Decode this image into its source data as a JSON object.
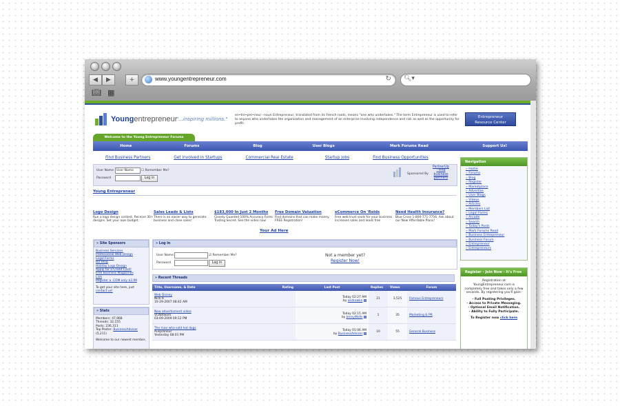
{
  "browser": {
    "url": "www.youngentrepreneur.com",
    "back_icon": "left-arrow-icon",
    "forward_icon": "right-arrow-icon",
    "add_icon": "plus-icon",
    "reload_icon": "reload-icon",
    "search_icon": "magnifier-icon",
    "bookmarks_icon": "book-icon",
    "grid_icon": "grid-icon"
  },
  "site": {
    "logo_brand": "Young",
    "logo_brand2": "entrepreneur",
    "tagline": "\"...inspiring millions.\"",
    "definition": "en•tre•pre•neur –noun Entrepreneur, translated from its French roots, means \"one who undertakes.\" The term Entrepreneur is used to refer to anyone who undertakes the organization and management of an enterprise involving independence and risk as well as the opportunity for profit.",
    "resource_center_line1": "Entrepreneur",
    "resource_center_line2": "Resource Center",
    "welcome_tab": "Welcome to the Young Entrepreneur Forums",
    "nav": [
      "Home",
      "Forums",
      "Blog",
      "User Blogs",
      "Mark Forums Read",
      "Support Us!"
    ],
    "subnav": [
      "Find Business Partners",
      "Get Involved in Startups",
      "Commercial Real Estate",
      "Startup Jobs",
      "Find Business Opportunities"
    ],
    "login": {
      "username_label": "User Name",
      "username_value": "User Name",
      "remember": "Remember Me?",
      "password_label": "Password",
      "button": "Log in"
    },
    "sponsor": {
      "sponsored_by": "Sponsored By",
      "partner_line1": "PartnerUp",
      "partner_line2": "- Find",
      "partner_line3": "business",
      "partner_line4": "partners"
    },
    "breadcrumb": "Young Entrepreneur",
    "ads": [
      {
        "title": "Logo Design",
        "text": "Run a logo design contest. Receive 30+ designs. Set your own budget."
      },
      {
        "title": "Sales Leads & Lists",
        "text": "There is an easier way to generate business and close sales!"
      },
      {
        "title": "$183,000 In Just 2 Months",
        "text": "Closely Guarded 100% Accuracy Forex Trading Secret. See the video now"
      },
      {
        "title": "Free Domain Valuation",
        "text": "Find domains that can make money. FREE Registration!"
      },
      {
        "title": "eCommerce On 'Roids",
        "text": "Free web trust seals for your business. Increases sales and leads free"
      },
      {
        "title": "Need Health Insurance?",
        "text": "Blue Cross 1-800-771-7756. Ask about our New Affordable Plans!"
      }
    ],
    "your_ad_here": "Your Ad Here",
    "site_sponsors": {
      "header": "» Site Sponsors",
      "links": [
        "Business Services",
        "Professional Web Design",
        "Legal Forms",
        "Biz Blog",
        "Holiday Logo Design",
        "Apply for a Credit Card!",
        "Free Business Magazines",
        "Link",
        "Register a .COM only $3.99"
      ],
      "footer": "To get your site here, just",
      "contact": "contact us!"
    },
    "stats": {
      "header": "» Stats",
      "members": "Members: 47,968",
      "threads": "Threads: 32,155",
      "posts": "Posts: 236,311",
      "top_poster_label": "Top Poster:",
      "top_poster": "BusinessAdviser",
      "top_poster_count": "(5,211)",
      "newest": "Welcome to our newest member,"
    },
    "login_panel": {
      "header": "» Log in",
      "username_label": "User Name",
      "remember": "Remember Me?",
      "password_label": "Password",
      "button": "Log in",
      "not_member": "Not a member yet?",
      "register": "Register Now!"
    },
    "recent_threads": {
      "header": "» Recent Threads",
      "columns": [
        "Title, Username, & Date",
        "Rating",
        "Last Post",
        "Replies",
        "Views",
        "Forum"
      ],
      "rows": [
        {
          "title": "Web Disney",
          "user": "Nick R",
          "date": "10-29-2007 08:42 AM",
          "last_time": "Today 02:27 AM",
          "last_by": "andrewkn",
          "replies": "21",
          "views": "3,525",
          "forum": "Famous Entrepreneurs"
        },
        {
          "title": "New advertisment video",
          "user": "VCNetwork",
          "date": "03-09-2009 09:12 PM",
          "last_time": "Today 02:15 AM",
          "last_by": "JennyWells",
          "replies": "1",
          "views": "35",
          "forum": "Marketing & PR"
        },
        {
          "title": "The man who sold hot dogs",
          "user": "Auspreneur",
          "date": "Yesterday 08:01 PM",
          "last_time": "Today 01:06 AM",
          "last_by": "BusinessAdviser",
          "replies": "10",
          "views": "55",
          "forum": "General Business"
        }
      ]
    },
    "navigation": {
      "header": "Navigation",
      "items": [
        "Home",
        "Forums",
        "Blog",
        "Register",
        "Marketplace",
        "Advertise",
        "User Blogs",
        "Videos",
        "Articles",
        "Members List",
        "Legal Forms",
        "Arcade",
        "Search",
        "Today's Posts",
        "Mark Forums Read",
        "Business Entrepreneur",
        "Business Forum",
        "Entrepreneur",
        "Entrepreneurs"
      ]
    },
    "register_box": {
      "header_a": "Register - Join Now - ",
      "header_b": "It's Free",
      "text": "Registration at YoungEntrepreneur.com is completely free and takes only a few seconds. By registering you'll gain:",
      "b1": "- Full Posting Privileges.",
      "b2": "- Access to Private Messaging.",
      "b3": "- Optional Email Notification.",
      "b4": "- Ability to Fully Participate.",
      "cta": "To Register now",
      "cta_link": "click here"
    }
  }
}
